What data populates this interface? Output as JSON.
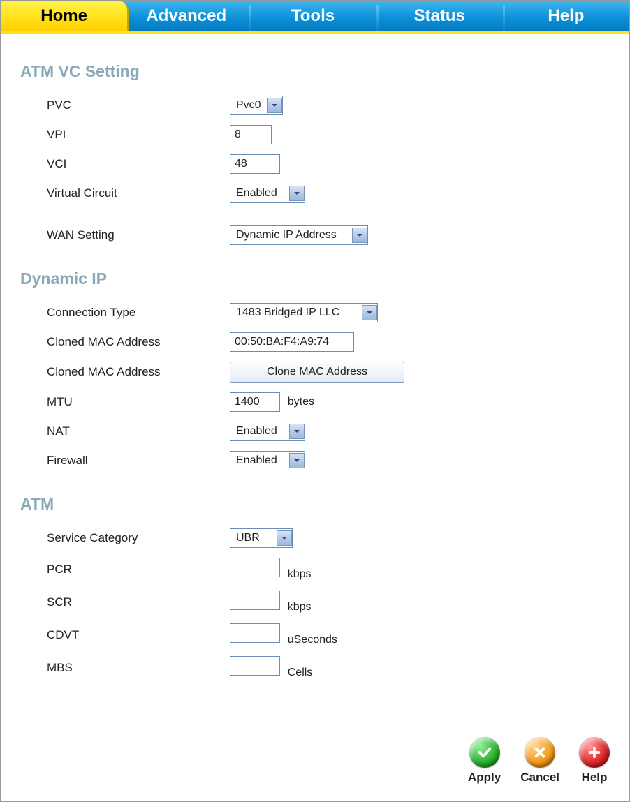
{
  "tabs": {
    "home": "Home",
    "advanced": "Advanced",
    "tools": "Tools",
    "status": "Status",
    "help": "Help"
  },
  "sections": {
    "atm_vc": "ATM VC Setting",
    "dynamic_ip": "Dynamic IP",
    "atm": "ATM"
  },
  "atm_vc": {
    "pvc_label": "PVC",
    "pvc_value": "Pvc0",
    "vpi_label": "VPI",
    "vpi_value": "8",
    "vci_label": "VCI",
    "vci_value": "48",
    "vc_label": "Virtual Circuit",
    "vc_value": "Enabled",
    "wan_label": "WAN Setting",
    "wan_value": "Dynamic IP Address"
  },
  "dyn": {
    "ct_label": "Connection Type",
    "ct_value": "1483 Bridged IP LLC",
    "mac_label": "Cloned MAC Address",
    "mac_value": "00:50:BA:F4:A9:74",
    "mac_btn_label": "Cloned MAC Address",
    "mac_btn": "Clone MAC Address",
    "mtu_label": "MTU",
    "mtu_value": "1400",
    "mtu_unit": "bytes",
    "nat_label": "NAT",
    "nat_value": "Enabled",
    "fw_label": "Firewall",
    "fw_value": "Enabled"
  },
  "atm": {
    "sc_label": "Service Category",
    "sc_value": "UBR",
    "pcr_label": "PCR",
    "pcr_value": "",
    "pcr_unit": "kbps",
    "scr_label": "SCR",
    "scr_value": "",
    "scr_unit": "kbps",
    "cdvt_label": "CDVT",
    "cdvt_value": "",
    "cdvt_unit": "uSeconds",
    "mbs_label": "MBS",
    "mbs_value": "",
    "mbs_unit": "Cells"
  },
  "actions": {
    "apply": "Apply",
    "cancel": "Cancel",
    "help": "Help"
  }
}
